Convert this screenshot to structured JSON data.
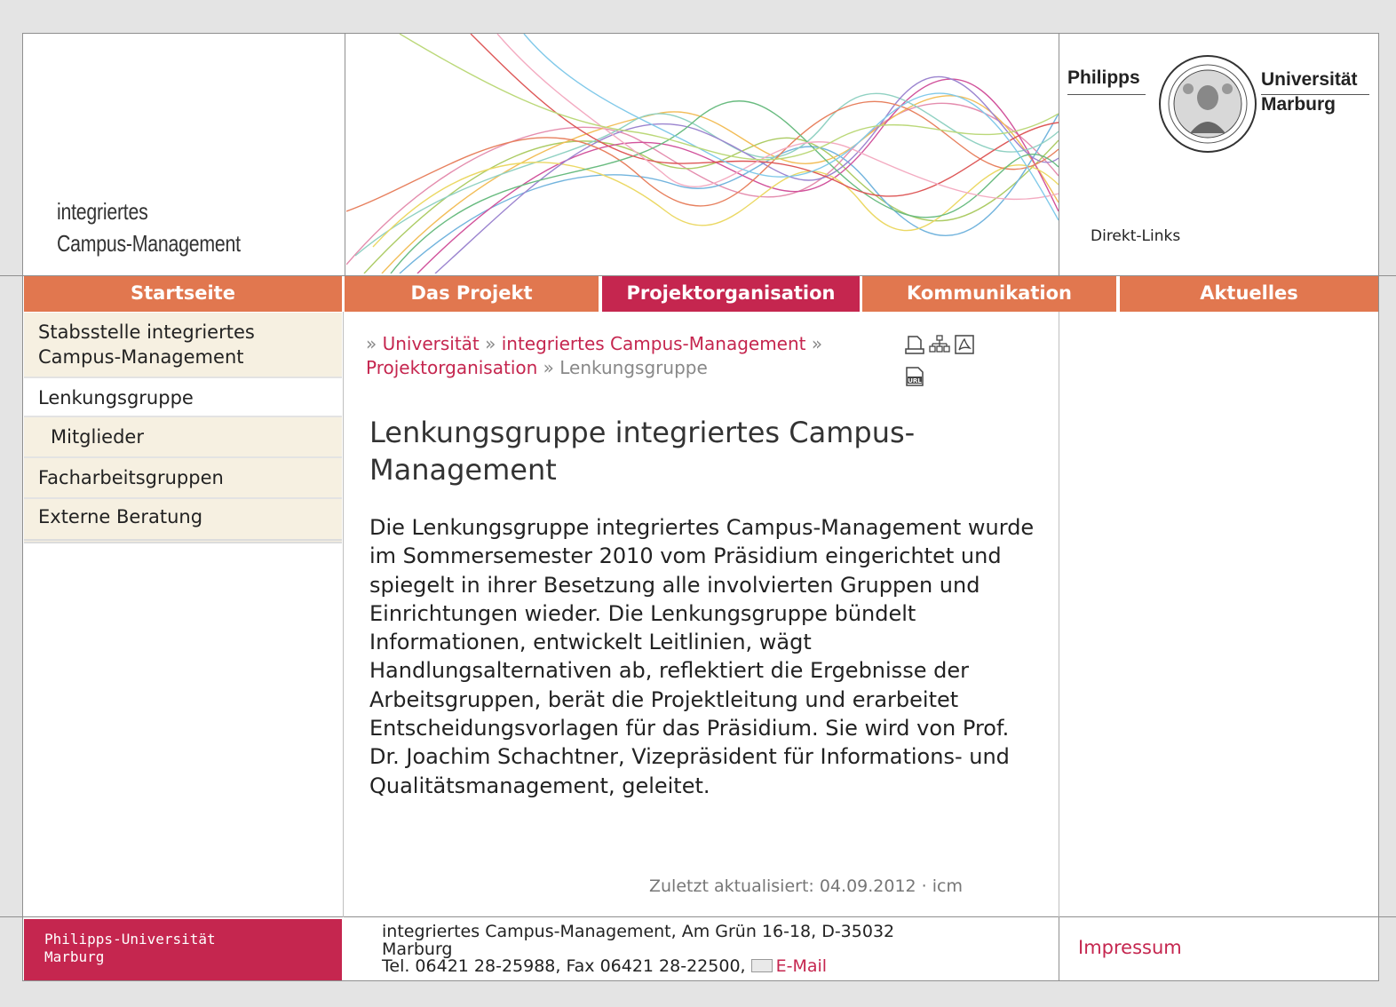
{
  "header": {
    "brand_line1": "integriertes",
    "brand_line2": "Campus-Management",
    "logo_left": "Philipps",
    "logo_right_line1": "Universität",
    "logo_right_line2": "Marburg",
    "direkt_links": "Direkt-Links"
  },
  "nav": {
    "items": [
      {
        "label": "Startseite"
      },
      {
        "label": "Das Projekt"
      },
      {
        "label": "Projektorganisation"
      },
      {
        "label": "Kommunikation"
      },
      {
        "label": "Aktuelles"
      }
    ]
  },
  "sidebar": {
    "items": [
      {
        "label": "Stabsstelle integriertes Campus-Management"
      },
      {
        "label": "Lenkungsgruppe"
      },
      {
        "label": "Mitglieder"
      },
      {
        "label": "Facharbeitsgruppen"
      },
      {
        "label": "Externe Beratung"
      }
    ]
  },
  "breadcrumb": {
    "sep": "»",
    "items": [
      "Universität",
      "integriertes Campus-Management",
      "Projektorganisation"
    ],
    "current": "Lenkungsgruppe"
  },
  "tools": {
    "icons": [
      "print-icon",
      "sitemap-icon",
      "pdf-icon",
      "url-icon"
    ]
  },
  "main": {
    "title": "Lenkungsgruppe integriertes Campus-Management",
    "paragraph": "Die Lenkungsgruppe integriertes Campus-Management wurde im Sommersemester 2010 vom Präsidium eingerichtet und spiegelt in ihrer Besetzung alle involvierten Gruppen und Einrichtungen wieder. Die Lenkungsgruppe bündelt Informationen, entwickelt Leitlinien, wägt Handlungsalternativen ab, reflektiert die Ergebnisse der Arbeitsgruppen, berät die Projektleitung und erarbeitet Entscheidungsvorlagen für das Präsidium. Sie wird von Prof. Dr. Joachim Schachtner, Vizepräsident für Informations- und Qualitätsmanagement, geleitet.",
    "updated": "Zuletzt aktualisiert: 04.09.2012 · icm"
  },
  "footer": {
    "uni_line1": "Philipps-Universität",
    "uni_line2": "Marburg",
    "address_line1": "integriertes Campus-Management, Am Grün 16-18, D-35032",
    "address_line2": "Marburg",
    "contact_text": "Tel. 06421 28-25988, Fax 06421 28-22500,",
    "email_label": "E-Mail",
    "impressum": "Impressum"
  },
  "colors": {
    "nav_orange": "#e1774f",
    "nav_active": "#c5264f",
    "link": "#c5264f",
    "sidebar_bg": "#f6f0e1"
  }
}
